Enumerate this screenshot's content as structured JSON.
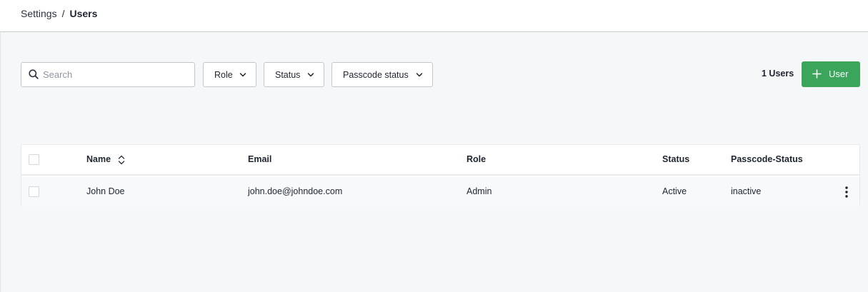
{
  "breadcrumb": {
    "parent": "Settings",
    "separator": "/",
    "current": "Users"
  },
  "toolbar": {
    "search_placeholder": "Search",
    "filters": {
      "role": "Role",
      "status": "Status",
      "passcode_status": "Passcode status"
    },
    "user_count": "1 Users",
    "add_user_label": "User"
  },
  "table": {
    "columns": [
      "Name",
      "Email",
      "Role",
      "Status",
      "Passcode-Status"
    ],
    "rows": [
      {
        "name": "John Doe",
        "email": "john.doe@johndoe.com",
        "role": "Admin",
        "status": "Active",
        "passcode_status": "inactive"
      }
    ]
  },
  "colors": {
    "accent": "#3ba55c",
    "background": "#f6f7f9"
  },
  "icons": {
    "search": "search-icon",
    "dropdown": "chevron-down-icon",
    "sort": "sort-icon",
    "add": "plus-icon",
    "row_menu": "more-vertical-icon"
  }
}
